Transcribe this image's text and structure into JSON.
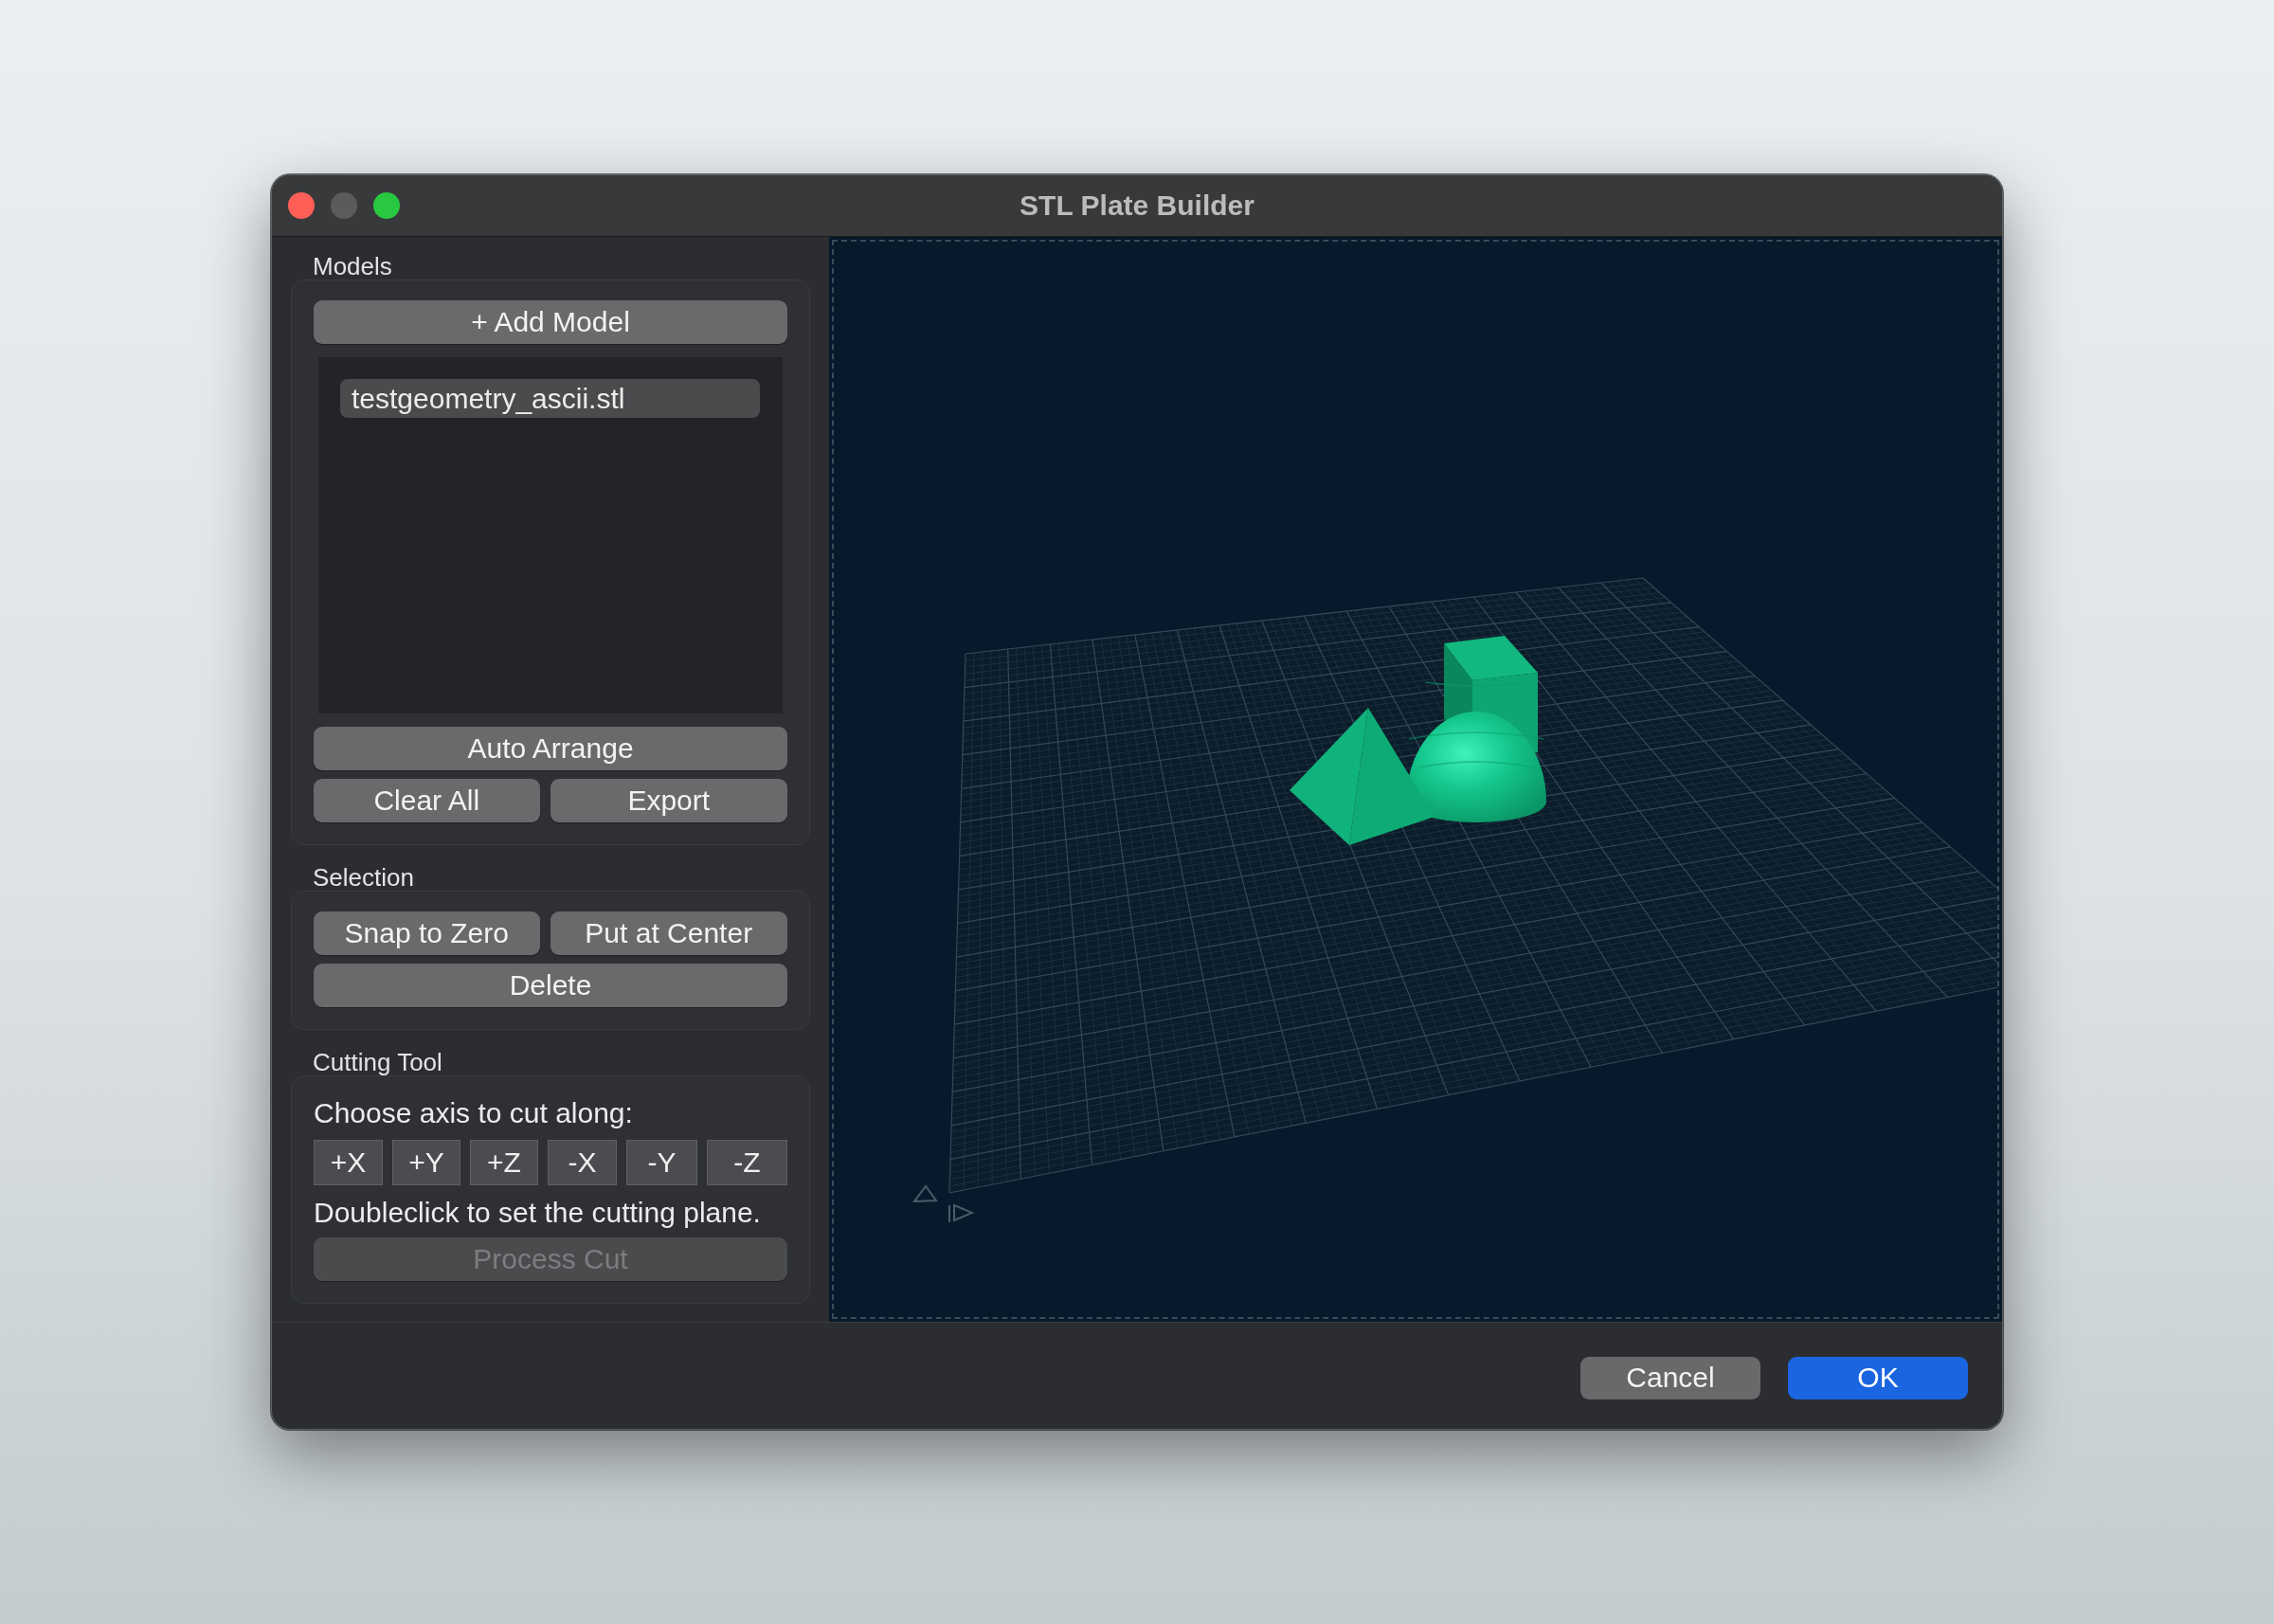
{
  "window": {
    "title": "STL Plate Builder",
    "controls": [
      {
        "kind": "close",
        "disabled": false
      },
      {
        "kind": "minimize",
        "disabled": true
      },
      {
        "kind": "zoom",
        "disabled": false
      }
    ]
  },
  "models": {
    "title": "Models",
    "add_button": "+ Add Model",
    "items": [
      {
        "label": "testgeometry_ascii.stl",
        "selected": true
      }
    ],
    "button_rows": [
      [
        "Auto Arrange"
      ],
      [
        "Clear All",
        "Export"
      ]
    ]
  },
  "selection": {
    "title": "Selection",
    "button_rows": [
      [
        "Snap to Zero",
        "Put at Center"
      ],
      [
        "Delete"
      ]
    ]
  },
  "cutting_tool": {
    "title": "Cutting Tool",
    "prompt": "Choose axis to cut along:",
    "axes": [
      {
        "label": "+X",
        "selected": false
      },
      {
        "label": "+Y",
        "selected": false
      },
      {
        "label": "+Z",
        "selected": false
      },
      {
        "label": "-X",
        "selected": false
      },
      {
        "label": "-Y",
        "selected": false
      },
      {
        "label": "-Z",
        "selected": false
      }
    ],
    "hint": "Doubleclick to set the cutting plane.",
    "process_button": {
      "label": "Process Cut",
      "disabled": true
    }
  },
  "dialog_buttons": [
    {
      "label": "Cancel",
      "default": false
    },
    {
      "label": "OK",
      "default": true
    }
  ]
}
